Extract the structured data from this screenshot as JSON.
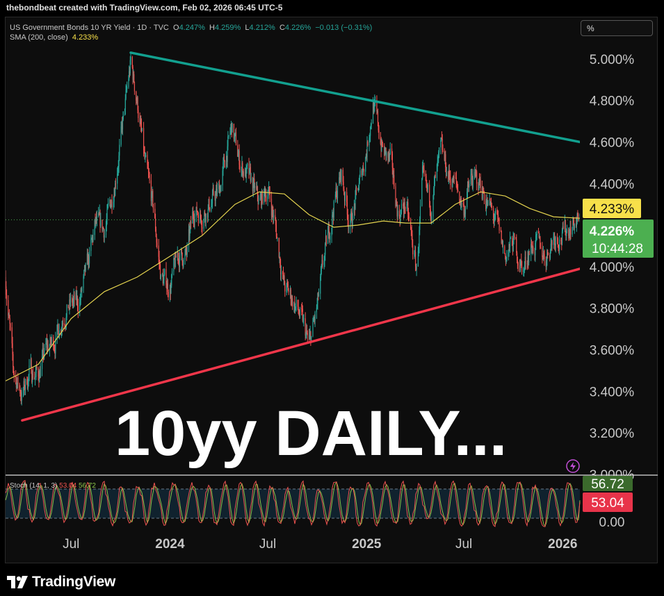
{
  "header": {
    "attribution": "thebondbeat created with TradingView.com, Feb 02, 2026 06:45 UTC-5"
  },
  "legend": {
    "symbol": "US Government Bonds 10 YR Yield · 1D · TVC",
    "o_label": "O",
    "o_value": "4.247%",
    "h_label": "H",
    "h_value": "4.259%",
    "l_label": "L",
    "l_value": "4.212%",
    "c_label": "C",
    "c_value": "4.226%",
    "change": "−0.013 (−0.31%)",
    "sma_label": "SMA (200, close)",
    "sma_value": "4.233%"
  },
  "scale_mode": "%",
  "overlay_text": "10yy DAILY...",
  "price_badges": {
    "sma": "4.233%",
    "last": "4.226%",
    "countdown": "10:44:28"
  },
  "stoch": {
    "label": "Stoch (14, 1, 3)",
    "k_value": "53.04",
    "d_value": "56.72",
    "k_badge": "53.04",
    "d_badge": "56.72",
    "bottom_tick": "0.00"
  },
  "colors": {
    "up": "#26a69a",
    "down": "#ef5350",
    "sma": "#e5d44f",
    "resistance": "#12a08f",
    "support": "#f2364a",
    "last_badge": "#4caf50",
    "sma_badge": "#f7e04a",
    "stoch_k": "#ef5350",
    "stoch_d": "#8bc34a"
  },
  "footer": {
    "brand": "TradingView"
  },
  "chart_data": {
    "type": "line",
    "title": "US Government Bonds 10 YR Yield",
    "y_unit": "%",
    "ylim": [
      3.0,
      5.2
    ],
    "y_ticks": [
      3.0,
      3.2,
      3.4,
      3.6,
      3.8,
      4.0,
      4.2,
      4.4,
      4.6,
      4.8,
      5.0
    ],
    "y_tick_labels": [
      "3.000%",
      "3.200%",
      "3.400%",
      "3.600%",
      "3.800%",
      "4.000%",
      "4.200%",
      "4.400%",
      "4.600%",
      "4.800%",
      "5.000%"
    ],
    "x_tick_labels": [
      "Jul",
      "2024",
      "Jul",
      "2025",
      "Jul",
      "2026"
    ],
    "x_tick_dates": [
      "2023-07-01",
      "2024-01-01",
      "2024-07-01",
      "2025-01-01",
      "2025-07-01",
      "2026-01-01"
    ],
    "xlim": [
      "2023-03-01",
      "2026-02-02"
    ],
    "grid": false,
    "series": [
      {
        "name": "US Government Bonds 10 YR Yield",
        "x": [
          "2023-03-01",
          "2023-03-15",
          "2023-04-01",
          "2023-04-15",
          "2023-05-01",
          "2023-05-15",
          "2023-06-01",
          "2023-06-15",
          "2023-07-01",
          "2023-07-15",
          "2023-08-01",
          "2023-08-15",
          "2023-09-01",
          "2023-09-15",
          "2023-10-01",
          "2023-10-20",
          "2023-11-01",
          "2023-11-15",
          "2023-12-01",
          "2023-12-15",
          "2024-01-01",
          "2024-01-15",
          "2024-02-01",
          "2024-02-15",
          "2024-03-01",
          "2024-03-15",
          "2024-04-01",
          "2024-04-25",
          "2024-05-10",
          "2024-06-01",
          "2024-06-15",
          "2024-07-01",
          "2024-07-15",
          "2024-08-01",
          "2024-08-15",
          "2024-09-01",
          "2024-09-16",
          "2024-10-01",
          "2024-10-15",
          "2024-11-01",
          "2024-11-15",
          "2024-12-01",
          "2024-12-15",
          "2025-01-01",
          "2025-01-13",
          "2025-02-01",
          "2025-02-15",
          "2025-03-01",
          "2025-03-15",
          "2025-04-04",
          "2025-04-15",
          "2025-05-01",
          "2025-05-20",
          "2025-06-01",
          "2025-06-15",
          "2025-07-01",
          "2025-07-15",
          "2025-08-01",
          "2025-08-15",
          "2025-09-01",
          "2025-09-16",
          "2025-10-01",
          "2025-10-20",
          "2025-11-01",
          "2025-11-15",
          "2025-12-01",
          "2025-12-15",
          "2026-01-01",
          "2026-01-15",
          "2026-02-02"
        ],
        "values": [
          3.95,
          3.5,
          3.38,
          3.5,
          3.48,
          3.6,
          3.65,
          3.76,
          3.82,
          3.82,
          4.0,
          4.2,
          4.18,
          4.33,
          4.6,
          4.98,
          4.8,
          4.5,
          4.28,
          3.95,
          3.9,
          4.05,
          4.05,
          4.28,
          4.25,
          4.3,
          4.36,
          4.67,
          4.5,
          4.4,
          4.3,
          4.38,
          4.2,
          3.9,
          3.85,
          3.75,
          3.62,
          3.8,
          4.05,
          4.3,
          4.45,
          4.2,
          4.35,
          4.57,
          4.79,
          4.55,
          4.5,
          4.25,
          4.3,
          3.98,
          4.4,
          4.3,
          4.55,
          4.45,
          4.4,
          4.28,
          4.42,
          4.4,
          4.3,
          4.2,
          4.05,
          4.12,
          3.98,
          4.1,
          4.1,
          4.05,
          4.15,
          4.15,
          4.2,
          4.226
        ]
      },
      {
        "name": "SMA (200, close)",
        "x": [
          "2023-03-01",
          "2023-05-01",
          "2023-07-01",
          "2023-09-01",
          "2023-11-01",
          "2024-01-01",
          "2024-03-01",
          "2024-05-01",
          "2024-06-15",
          "2024-08-01",
          "2024-09-16",
          "2024-11-01",
          "2024-12-15",
          "2025-02-01",
          "2025-03-15",
          "2025-05-01",
          "2025-06-15",
          "2025-08-01",
          "2025-09-16",
          "2025-11-01",
          "2025-12-15",
          "2026-02-02"
        ],
        "values": [
          3.45,
          3.53,
          3.75,
          3.88,
          3.95,
          4.05,
          4.15,
          4.3,
          4.36,
          4.35,
          4.25,
          4.19,
          4.2,
          4.22,
          4.21,
          4.21,
          4.3,
          4.36,
          4.34,
          4.28,
          4.24,
          4.233
        ]
      }
    ],
    "trendlines": [
      {
        "name": "resistance",
        "from": [
          "2023-10-20",
          5.03
        ],
        "to": [
          "2026-02-02",
          4.6
        ]
      },
      {
        "name": "support",
        "from": [
          "2023-04-01",
          3.26
        ],
        "to": [
          "2026-02-02",
          3.99
        ]
      }
    ],
    "stochastic": {
      "name": "Stoch (14, 1, 3)",
      "ylim": [
        0,
        100
      ],
      "bands": [
        20,
        80
      ],
      "last_k": 53.04,
      "last_d": 56.72
    }
  }
}
